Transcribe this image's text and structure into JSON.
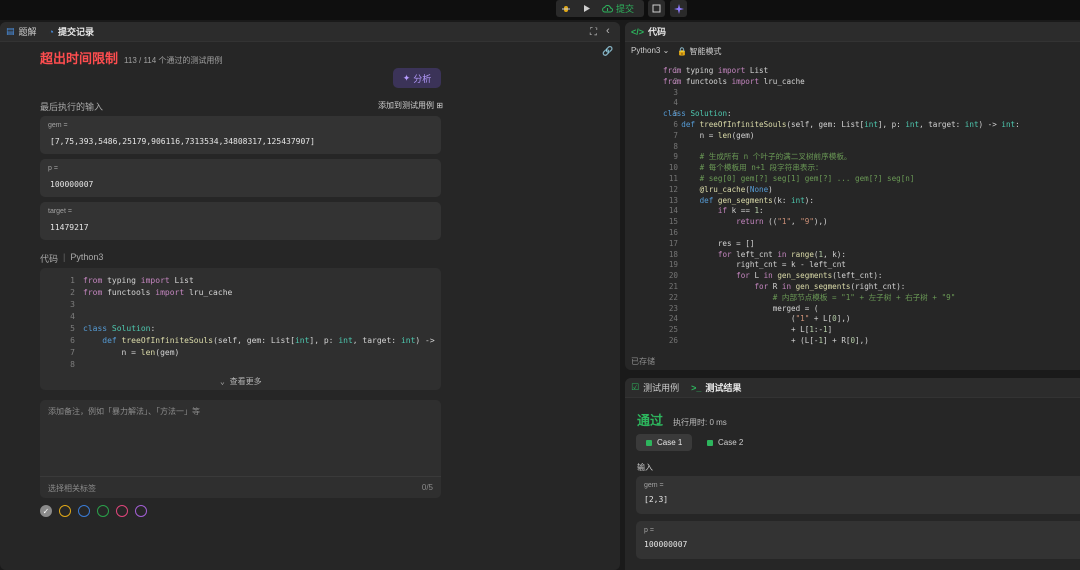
{
  "topbar": {
    "submit_label": "提交"
  },
  "left": {
    "tabs": [
      "题解",
      "提交记录"
    ],
    "status_title": "超出时间限制",
    "status_meta": "113 / 114 个通过的测试用例",
    "analyze_label": "分析",
    "last_input_label": "最后执行的输入",
    "add_case_label": "添加到测试用例",
    "inputs": [
      {
        "label": "gem =",
        "value": "[7,75,393,5486,25179,906116,7313534,34808317,125437907]"
      },
      {
        "label": "p =",
        "value": "100000007"
      },
      {
        "label": "target =",
        "value": "11479217"
      }
    ],
    "code_label": "代码",
    "code_lang": "Python3",
    "see_more": "查看更多",
    "note_placeholder": "添加备注，例如「暴力解法」、「方法一」等",
    "tag_placeholder": "选择相关标签",
    "tag_counter": "0/5",
    "color_dots": [
      "#8a8a8a",
      "#e0a817",
      "#3a7bd5",
      "#2aa14a",
      "#e0457b",
      "#a35fd6"
    ]
  },
  "code": {
    "title": "代码",
    "lang": "Python3",
    "mode": "智能模式",
    "saved": "已存储"
  },
  "test": {
    "tabs": [
      "测试用例",
      "测试结果"
    ],
    "result": "通过",
    "exec_time": "执行用时: 0 ms",
    "cases": [
      "Case 1",
      "Case 2"
    ],
    "input_label": "输入",
    "inputs": [
      {
        "label": "gem =",
        "value": "[2,3]"
      },
      {
        "label": "p =",
        "value": "100000007"
      }
    ]
  }
}
